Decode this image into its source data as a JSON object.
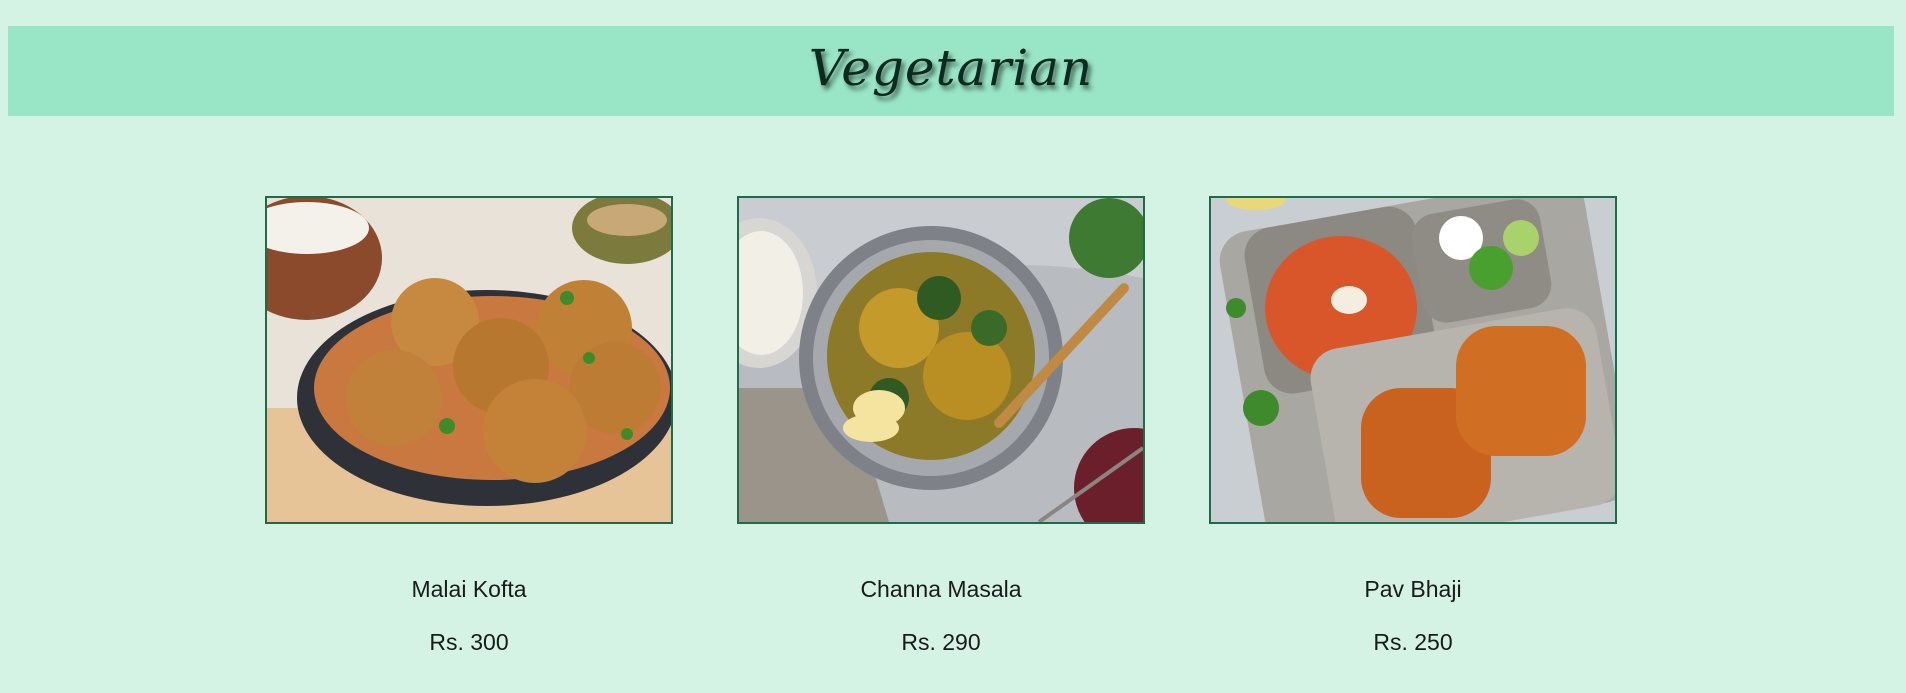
{
  "header": {
    "title": "Vegetarian"
  },
  "menu": {
    "items": [
      {
        "name": "Malai Kofta",
        "price": "Rs. 300",
        "image_icon": "malai-kofta-photo"
      },
      {
        "name": "Channa Masala",
        "price": "Rs. 290",
        "image_icon": "channa-masala-photo"
      },
      {
        "name": "Pav Bhaji",
        "price": "Rs. 250",
        "image_icon": "pav-bhaji-photo"
      }
    ]
  },
  "colors": {
    "page_bg": "#d5f3e5",
    "banner_bg": "#98e6c6",
    "card_border": "#1e6b4a"
  }
}
